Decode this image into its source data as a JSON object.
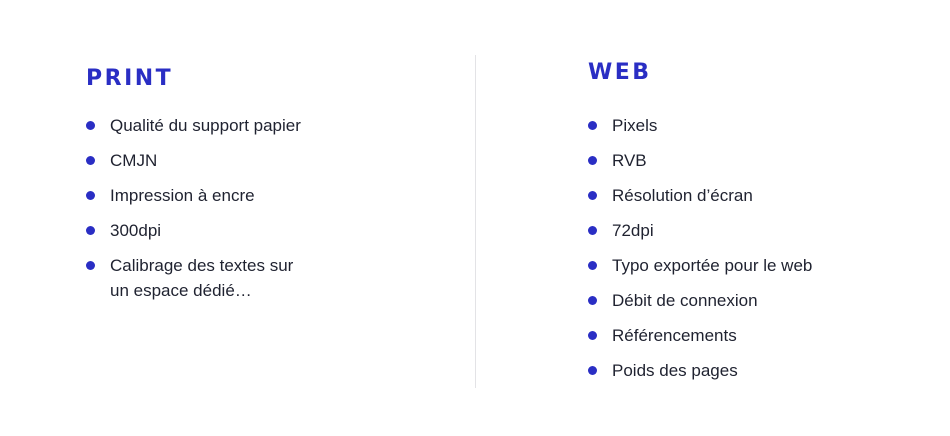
{
  "colors": {
    "accent": "#2a2ec4",
    "text": "#1f2230",
    "divider": "#e3e3e6",
    "background": "#ffffff"
  },
  "print": {
    "title": "PRINT",
    "items": [
      "Qualité du support papier",
      "CMJN",
      "Impression à encre",
      "300dpi",
      "Calibrage des textes sur\nun espace dédié…"
    ]
  },
  "web": {
    "title": "WEB",
    "items": [
      "Pixels",
      "RVB",
      "Résolution d’écran",
      "72dpi",
      "Typo exportée pour le web",
      "Débit de connexion",
      "Référencements",
      "Poids des pages"
    ]
  }
}
